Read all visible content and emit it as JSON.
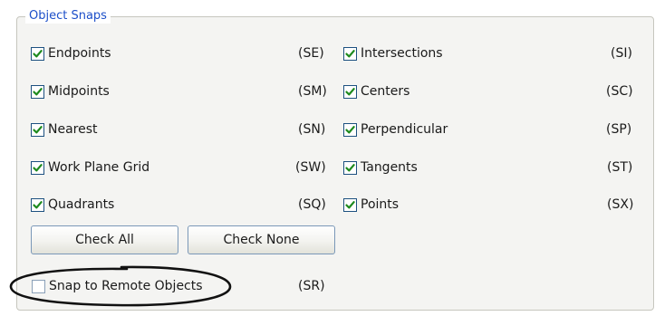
{
  "group": {
    "title": "Object Snaps"
  },
  "left_column": [
    {
      "label": "Endpoints",
      "code": "(SE)",
      "checked": true
    },
    {
      "label": "Midpoints",
      "code": "(SM)",
      "checked": true
    },
    {
      "label": "Nearest",
      "code": "(SN)",
      "checked": true
    },
    {
      "label": "Work Plane Grid",
      "code": "(SW)",
      "checked": true
    },
    {
      "label": "Quadrants",
      "code": "(SQ)",
      "checked": true
    }
  ],
  "right_column": [
    {
      "label": "Intersections",
      "code": "(SI)",
      "checked": true
    },
    {
      "label": "Centers",
      "code": "(SC)",
      "checked": true
    },
    {
      "label": "Perpendicular",
      "code": "(SP)",
      "checked": true
    },
    {
      "label": "Tangents",
      "code": "(ST)",
      "checked": true
    },
    {
      "label": "Points",
      "code": "(SX)",
      "checked": true
    }
  ],
  "buttons": {
    "check_all": "Check All",
    "check_none": "Check None"
  },
  "remote": {
    "label": "Snap to Remote Objects",
    "code": "(SR)",
    "checked": false
  },
  "colors": {
    "legend": "#1c4fc9",
    "checkmark": "#1e8a1e",
    "checkbox_border": "#1d5180",
    "annotation": "#111111"
  }
}
